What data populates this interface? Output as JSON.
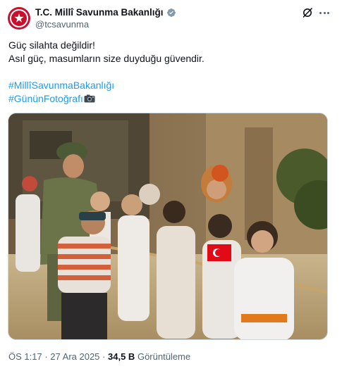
{
  "account": {
    "display_name": "T.C. Millî Savunma Bakanlığı",
    "handle": "@tcsavunma",
    "verified": true,
    "badge_color": "#829aab"
  },
  "tweet": {
    "lines": [
      "Güç silahta değildir!",
      "Asıl güç, masumların size duyduğu güvendir."
    ],
    "hashtags": [
      "#MillîSavunmaBakanlığı",
      "#GününFotoğrafı"
    ],
    "hashtag_emoji": "camera-emoji",
    "hashtag_color": "#1d9bf0"
  },
  "photo": {
    "image": "soldier-and-girls-tug-of-war"
  },
  "meta": {
    "time": "ÖS 1:17",
    "separator": "·",
    "date": "27 Ara 2025",
    "view_count": "34,5 B",
    "view_label": "Görüntüleme"
  },
  "icons": {
    "grok": "grok-icon",
    "more": "more-icon"
  }
}
